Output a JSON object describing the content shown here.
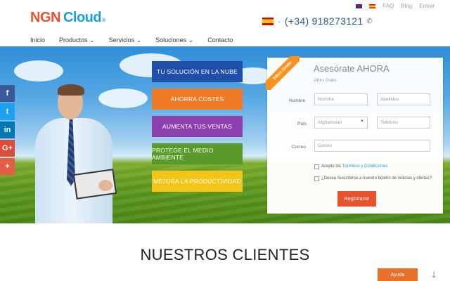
{
  "topbar": {
    "faq": "FAQ",
    "blog": "Blog",
    "login": "Entrar"
  },
  "logo": {
    "ngn": "NGN",
    "cloud": "Cloud",
    "reg": "®"
  },
  "phone": "(+34) 918273121",
  "nav": [
    "Inicio",
    "Productos ⌄",
    "Servicios ⌄",
    "Soluciones ⌄",
    "Contacto"
  ],
  "tiles": [
    {
      "label": "TU SOLUCIÓN EN LA NUBE",
      "color": "#1f4fa8"
    },
    {
      "label": "AHORRA COSTES",
      "color": "#f07b26"
    },
    {
      "label": "AUMENTA TUS VENTAS",
      "color": "#8e3fb0"
    },
    {
      "label": "PROTEGE EL MEDIO AMBIENTE",
      "color": "#5a9a2a"
    },
    {
      "label": "MEJORA LA PRODUCTIVIDAD",
      "color": "#f2c518"
    }
  ],
  "social": [
    "f",
    "t",
    "in",
    "G+",
    "+"
  ],
  "form": {
    "ribbon": "24hrs Gratis",
    "title": "Asesórate AHORA",
    "subtitle": "24hrs Gratis",
    "name_label": "Nombre",
    "name_placeholder": "Nombre",
    "lastname_placeholder": "Apellidos",
    "country_label": "País",
    "country_value": "Afghanistan",
    "phone_placeholder": "Teléfono",
    "email_label": "Correo",
    "email_placeholder": "Correo",
    "terms_prefix": "Acepto los ",
    "terms_link": "Términos y Condiciones",
    "newsletter": "¿Desea Suscribirse a nuestro boletín de noticias y ofertas?",
    "submit": "Registrarse"
  },
  "clients_title": "NUESTROS CLIENTES",
  "help_button": "Ayuda"
}
